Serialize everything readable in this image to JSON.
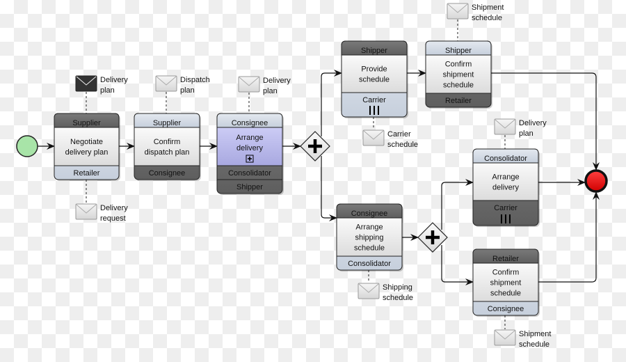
{
  "colors": {
    "dark_band": "#6e6e6e",
    "light_band": "#d3dbe6",
    "body": "#efefef",
    "sub_body": "#b9b9ee",
    "start": "#a8e0a8",
    "end": "#e81818"
  },
  "tasks": [
    {
      "id": "t1",
      "name": [
        "Negotiate",
        "delivery plan"
      ],
      "top": "Supplier",
      "bottom": [
        "Retailer"
      ],
      "top_dark": true
    },
    {
      "id": "t2",
      "name": [
        "Confirm",
        "dispatch plan"
      ],
      "top": "Supplier",
      "bottom": [
        "Consignee"
      ],
      "top_dark": false
    },
    {
      "id": "t3",
      "name": [
        "Arrange",
        "delivery"
      ],
      "top": "Consignee",
      "bottom": [
        "Consolidator",
        "Shipper"
      ],
      "top_dark": false,
      "subprocess": true
    },
    {
      "id": "t4",
      "name": [
        "Provide",
        "schedule"
      ],
      "top": "Shipper",
      "bottom": [
        "Carrier"
      ],
      "top_dark": true,
      "multi": true
    },
    {
      "id": "t5",
      "name": [
        "Confirm",
        "shipment",
        "schedule"
      ],
      "top": "Shipper",
      "bottom": [
        "Retailer"
      ],
      "top_dark": false
    },
    {
      "id": "t6",
      "name": [
        "Arrange",
        "shipping",
        "schedule"
      ],
      "top": "Consignee",
      "bottom": [
        "Consolidator"
      ],
      "top_dark": true
    },
    {
      "id": "t7",
      "name": [
        "Arrange",
        "delivery"
      ],
      "top": "Consolidator",
      "bottom": [
        "Carrier"
      ],
      "top_dark": false,
      "multi": true
    },
    {
      "id": "t8",
      "name": [
        "Confirm",
        "shipment",
        "schedule"
      ],
      "top": "Retailer",
      "bottom": [
        "Consignee"
      ],
      "top_dark": true
    }
  ],
  "messages": [
    {
      "id": "m1",
      "label": [
        "Delivery",
        "plan"
      ],
      "dark": true
    },
    {
      "id": "m2",
      "label": [
        "Dispatch",
        "plan"
      ]
    },
    {
      "id": "m3",
      "label": [
        "Delivery",
        "plan"
      ]
    },
    {
      "id": "m4",
      "label": [
        "Delivery",
        "request"
      ]
    },
    {
      "id": "m5",
      "label": [
        "Shipment",
        "schedule"
      ]
    },
    {
      "id": "m6",
      "label": [
        "Carrier",
        "schedule"
      ]
    },
    {
      "id": "m7",
      "label": [
        "Delivery",
        "plan"
      ]
    },
    {
      "id": "m8",
      "label": [
        "Shipping",
        "schedule"
      ]
    },
    {
      "id": "m9",
      "label": [
        "Shipment",
        "schedule"
      ]
    }
  ],
  "gateways": [
    {
      "id": "g1",
      "type": "parallel"
    },
    {
      "id": "g2",
      "type": "parallel"
    }
  ],
  "events": {
    "start": "start-event",
    "end": "end-event"
  }
}
